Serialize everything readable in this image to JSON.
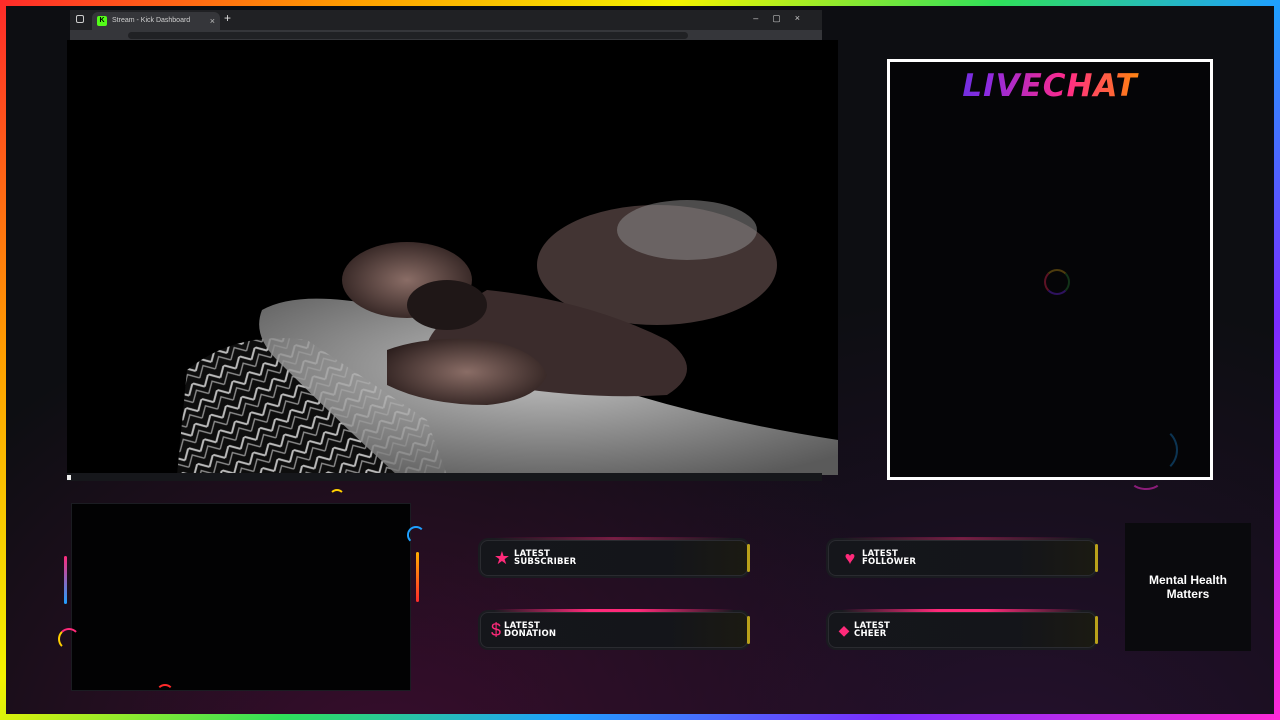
{
  "browser": {
    "tab_title": "Stream - Kick Dashboard",
    "tab_icon": "kick-logo-icon",
    "new_tab_label": "+",
    "tab_close_label": "×",
    "window_controls": "–▢×",
    "kick_letter": "K"
  },
  "livechat": {
    "title": "LIVECHAT"
  },
  "alerts": {
    "latest_subscriber": {
      "line1": "LATEST",
      "line2": "SUBSCRIBER",
      "icon": "star-icon",
      "glyph": "★"
    },
    "latest_follower": {
      "line1": "LATEST",
      "line2": "FOLLOWER",
      "icon": "heart-icon",
      "glyph": "♥"
    },
    "latest_donation": {
      "line1": "LATEST",
      "line2": "DONATION",
      "icon": "dollar-icon",
      "glyph": "$"
    },
    "latest_cheer": {
      "line1": "LATEST",
      "line2": "CHEER",
      "icon": "diamond-icon",
      "glyph": "◆"
    }
  },
  "banner": {
    "line1": "Mental Health",
    "line2": "Matters"
  },
  "colors": {
    "accent_pink": "#ff2a7a",
    "accent_gold": "#b9a11a",
    "kick_green": "#53fc18",
    "frame_border": "#ffffff"
  }
}
